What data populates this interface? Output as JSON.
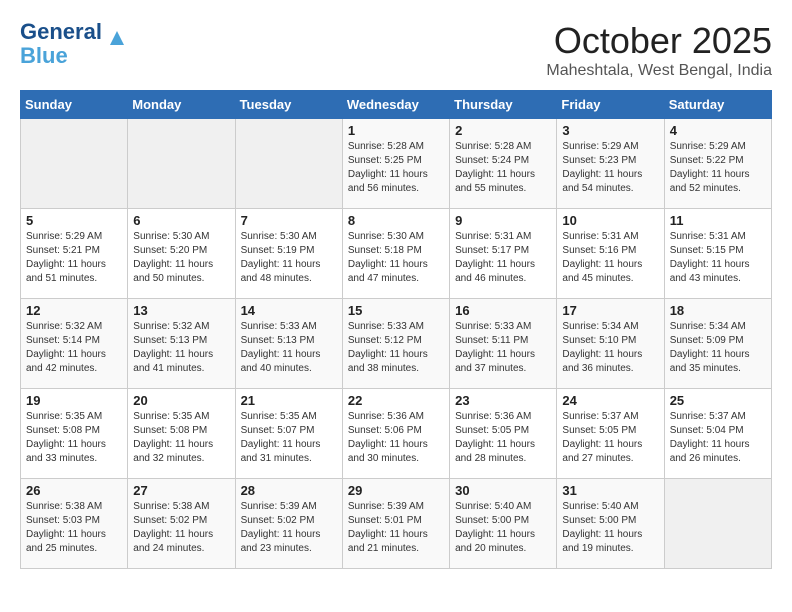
{
  "header": {
    "logo_line1": "General",
    "logo_line2": "Blue",
    "month": "October 2025",
    "location": "Maheshtala, West Bengal, India"
  },
  "days_of_week": [
    "Sunday",
    "Monday",
    "Tuesday",
    "Wednesday",
    "Thursday",
    "Friday",
    "Saturday"
  ],
  "weeks": [
    [
      {
        "day": "",
        "info": ""
      },
      {
        "day": "",
        "info": ""
      },
      {
        "day": "",
        "info": ""
      },
      {
        "day": "1",
        "info": "Sunrise: 5:28 AM\nSunset: 5:25 PM\nDaylight: 11 hours\nand 56 minutes."
      },
      {
        "day": "2",
        "info": "Sunrise: 5:28 AM\nSunset: 5:24 PM\nDaylight: 11 hours\nand 55 minutes."
      },
      {
        "day": "3",
        "info": "Sunrise: 5:29 AM\nSunset: 5:23 PM\nDaylight: 11 hours\nand 54 minutes."
      },
      {
        "day": "4",
        "info": "Sunrise: 5:29 AM\nSunset: 5:22 PM\nDaylight: 11 hours\nand 52 minutes."
      }
    ],
    [
      {
        "day": "5",
        "info": "Sunrise: 5:29 AM\nSunset: 5:21 PM\nDaylight: 11 hours\nand 51 minutes."
      },
      {
        "day": "6",
        "info": "Sunrise: 5:30 AM\nSunset: 5:20 PM\nDaylight: 11 hours\nand 50 minutes."
      },
      {
        "day": "7",
        "info": "Sunrise: 5:30 AM\nSunset: 5:19 PM\nDaylight: 11 hours\nand 48 minutes."
      },
      {
        "day": "8",
        "info": "Sunrise: 5:30 AM\nSunset: 5:18 PM\nDaylight: 11 hours\nand 47 minutes."
      },
      {
        "day": "9",
        "info": "Sunrise: 5:31 AM\nSunset: 5:17 PM\nDaylight: 11 hours\nand 46 minutes."
      },
      {
        "day": "10",
        "info": "Sunrise: 5:31 AM\nSunset: 5:16 PM\nDaylight: 11 hours\nand 45 minutes."
      },
      {
        "day": "11",
        "info": "Sunrise: 5:31 AM\nSunset: 5:15 PM\nDaylight: 11 hours\nand 43 minutes."
      }
    ],
    [
      {
        "day": "12",
        "info": "Sunrise: 5:32 AM\nSunset: 5:14 PM\nDaylight: 11 hours\nand 42 minutes."
      },
      {
        "day": "13",
        "info": "Sunrise: 5:32 AM\nSunset: 5:13 PM\nDaylight: 11 hours\nand 41 minutes."
      },
      {
        "day": "14",
        "info": "Sunrise: 5:33 AM\nSunset: 5:13 PM\nDaylight: 11 hours\nand 40 minutes."
      },
      {
        "day": "15",
        "info": "Sunrise: 5:33 AM\nSunset: 5:12 PM\nDaylight: 11 hours\nand 38 minutes."
      },
      {
        "day": "16",
        "info": "Sunrise: 5:33 AM\nSunset: 5:11 PM\nDaylight: 11 hours\nand 37 minutes."
      },
      {
        "day": "17",
        "info": "Sunrise: 5:34 AM\nSunset: 5:10 PM\nDaylight: 11 hours\nand 36 minutes."
      },
      {
        "day": "18",
        "info": "Sunrise: 5:34 AM\nSunset: 5:09 PM\nDaylight: 11 hours\nand 35 minutes."
      }
    ],
    [
      {
        "day": "19",
        "info": "Sunrise: 5:35 AM\nSunset: 5:08 PM\nDaylight: 11 hours\nand 33 minutes."
      },
      {
        "day": "20",
        "info": "Sunrise: 5:35 AM\nSunset: 5:08 PM\nDaylight: 11 hours\nand 32 minutes."
      },
      {
        "day": "21",
        "info": "Sunrise: 5:35 AM\nSunset: 5:07 PM\nDaylight: 11 hours\nand 31 minutes."
      },
      {
        "day": "22",
        "info": "Sunrise: 5:36 AM\nSunset: 5:06 PM\nDaylight: 11 hours\nand 30 minutes."
      },
      {
        "day": "23",
        "info": "Sunrise: 5:36 AM\nSunset: 5:05 PM\nDaylight: 11 hours\nand 28 minutes."
      },
      {
        "day": "24",
        "info": "Sunrise: 5:37 AM\nSunset: 5:05 PM\nDaylight: 11 hours\nand 27 minutes."
      },
      {
        "day": "25",
        "info": "Sunrise: 5:37 AM\nSunset: 5:04 PM\nDaylight: 11 hours\nand 26 minutes."
      }
    ],
    [
      {
        "day": "26",
        "info": "Sunrise: 5:38 AM\nSunset: 5:03 PM\nDaylight: 11 hours\nand 25 minutes."
      },
      {
        "day": "27",
        "info": "Sunrise: 5:38 AM\nSunset: 5:02 PM\nDaylight: 11 hours\nand 24 minutes."
      },
      {
        "day": "28",
        "info": "Sunrise: 5:39 AM\nSunset: 5:02 PM\nDaylight: 11 hours\nand 23 minutes."
      },
      {
        "day": "29",
        "info": "Sunrise: 5:39 AM\nSunset: 5:01 PM\nDaylight: 11 hours\nand 21 minutes."
      },
      {
        "day": "30",
        "info": "Sunrise: 5:40 AM\nSunset: 5:00 PM\nDaylight: 11 hours\nand 20 minutes."
      },
      {
        "day": "31",
        "info": "Sunrise: 5:40 AM\nSunset: 5:00 PM\nDaylight: 11 hours\nand 19 minutes."
      },
      {
        "day": "",
        "info": ""
      }
    ]
  ]
}
